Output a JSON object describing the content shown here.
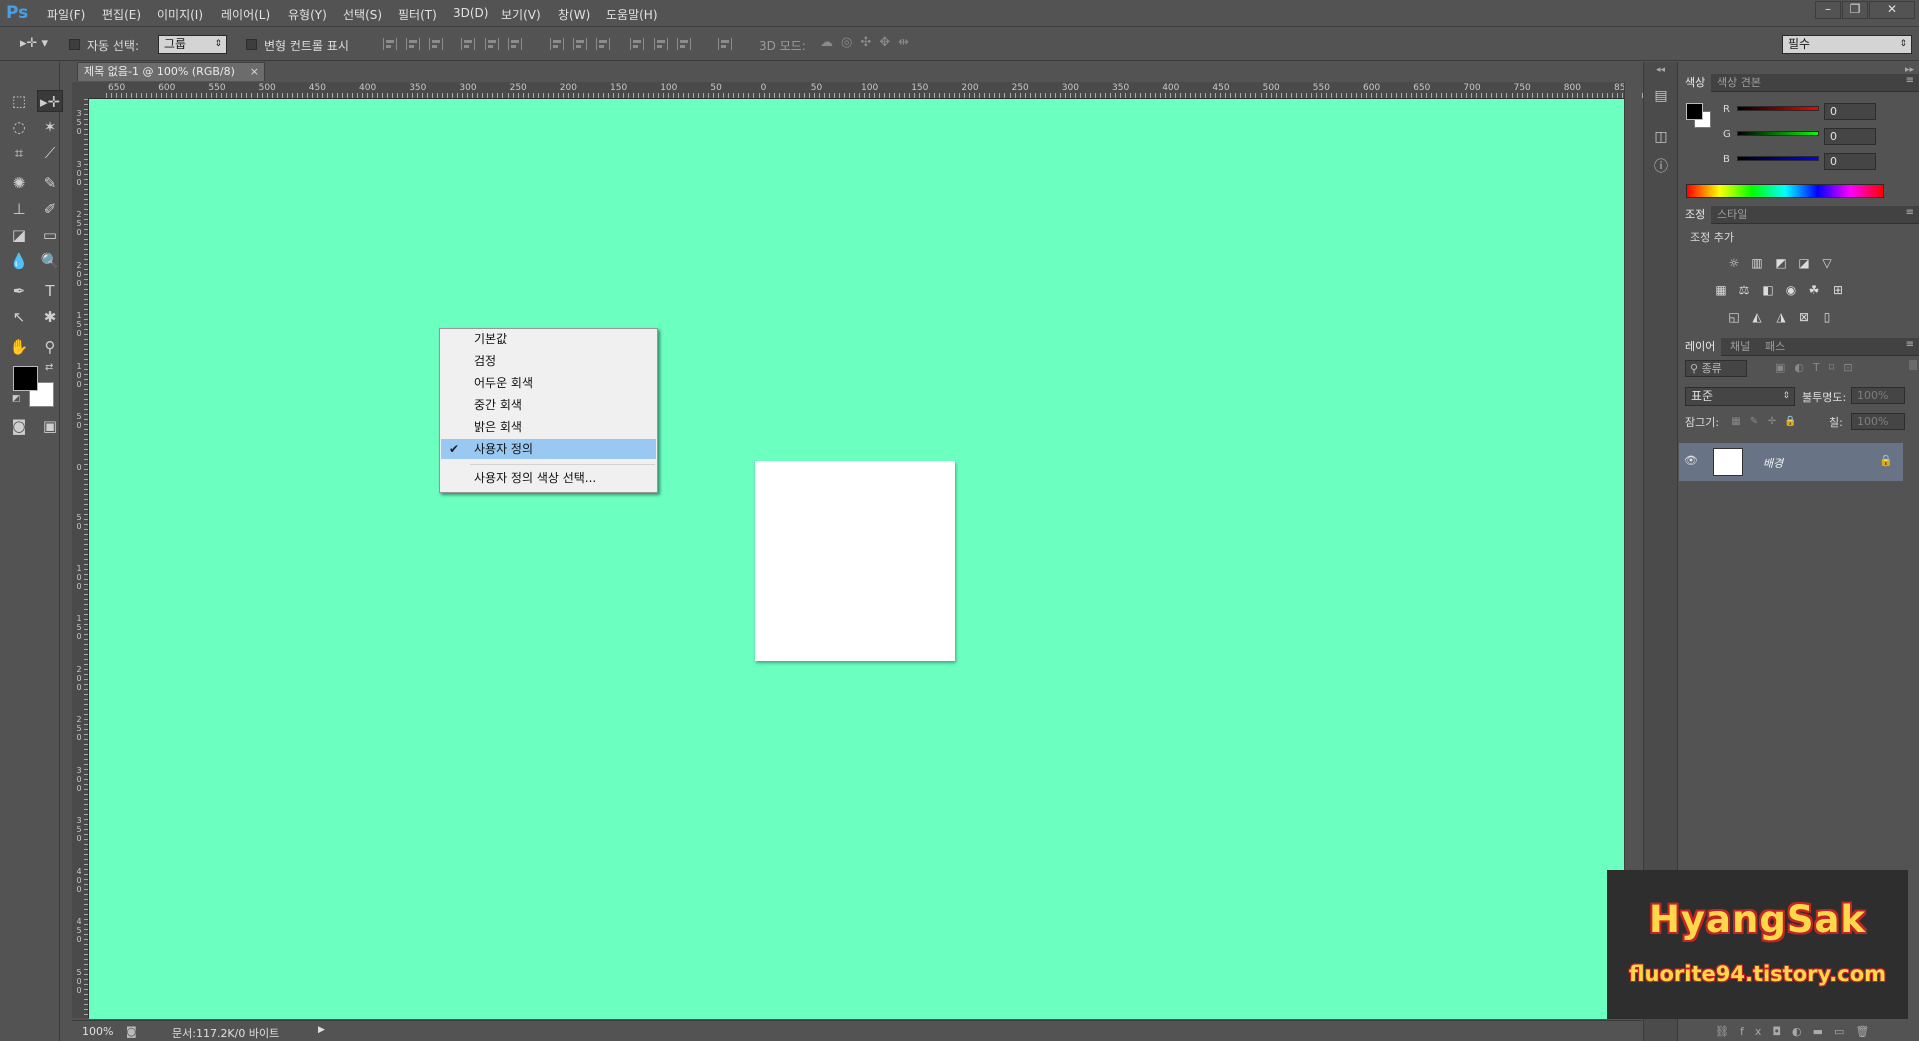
{
  "app": {
    "logo": "Ps",
    "menus": [
      "파일(F)",
      "편집(E)",
      "이미지(I)",
      "레이어(L)",
      "유형(Y)",
      "선택(S)",
      "필터(T)",
      "3D(D)",
      "보기(V)",
      "창(W)",
      "도움말(H)"
    ],
    "window_buttons": [
      "minimize",
      "restore",
      "close"
    ]
  },
  "options_bar": {
    "auto_select_label": "자동 선택:",
    "auto_select_value": "그룹",
    "transform_controls_label": "변형 컨트롤 표시",
    "three_d_mode_label": "3D 모드:",
    "workspace": "필수"
  },
  "document": {
    "tab_title": "제목 없음-1 @ 100% (RGB/8)",
    "canvas_color": "#6bffc0",
    "ruler_h_labels": [
      "650",
      "600",
      "550",
      "500",
      "450",
      "400",
      "350",
      "300",
      "250",
      "200",
      "150",
      "100",
      "50",
      "0",
      "50",
      "100",
      "150",
      "200",
      "250",
      "300",
      "350",
      "400",
      "450",
      "500",
      "550",
      "600",
      "650",
      "700",
      "750",
      "800",
      "85"
    ],
    "ruler_v_labels": [
      "3 5 0",
      "3 0 0",
      "2 5 0",
      "2 0 0",
      "1 5 0",
      "1 0 0",
      "5 0",
      "0",
      "5 0",
      "1 0 0",
      "1 5 0",
      "2 0 0",
      "2 5 0",
      "3 0 0",
      "3 5 0",
      "4 0 0",
      "4 5 0",
      "5 0 0"
    ]
  },
  "context_menu": {
    "items": [
      {
        "label": "기본값",
        "checked": false
      },
      {
        "label": "검정",
        "checked": false
      },
      {
        "label": "어두운 회색",
        "checked": false
      },
      {
        "label": "중간 회색",
        "checked": false
      },
      {
        "label": "밝은 회색",
        "checked": false
      },
      {
        "label": "사용자 정의",
        "checked": true
      }
    ],
    "custom_color_item": "사용자 정의 색상 선택..."
  },
  "status_bar": {
    "zoom": "100%",
    "doc_info": "문서:117.2K/0 바이트"
  },
  "color_panel": {
    "tabs": [
      "색상",
      "색상 견본"
    ],
    "channels": [
      {
        "name": "R",
        "value": "0",
        "color": "#e02020"
      },
      {
        "name": "G",
        "value": "0",
        "color": "#20c020"
      },
      {
        "name": "B",
        "value": "0",
        "color": "#2020e0"
      }
    ]
  },
  "adjustments_panel": {
    "tabs": [
      "조정",
      "스타일"
    ],
    "add_label": "조정 추가"
  },
  "layers_panel": {
    "tabs": [
      "레이어",
      "채널",
      "패스"
    ],
    "filter_label": "종류",
    "blend_mode": "표준",
    "opacity_label": "불투명도:",
    "opacity_value": "100%",
    "lock_label": "잠그기:",
    "fill_label": "칠:",
    "fill_value": "100%",
    "layers": [
      {
        "name": "배경",
        "visible": true,
        "locked": true
      }
    ]
  },
  "watermark": {
    "title": "HyangSak",
    "subtitle": "fluorite94.tistory.com"
  }
}
